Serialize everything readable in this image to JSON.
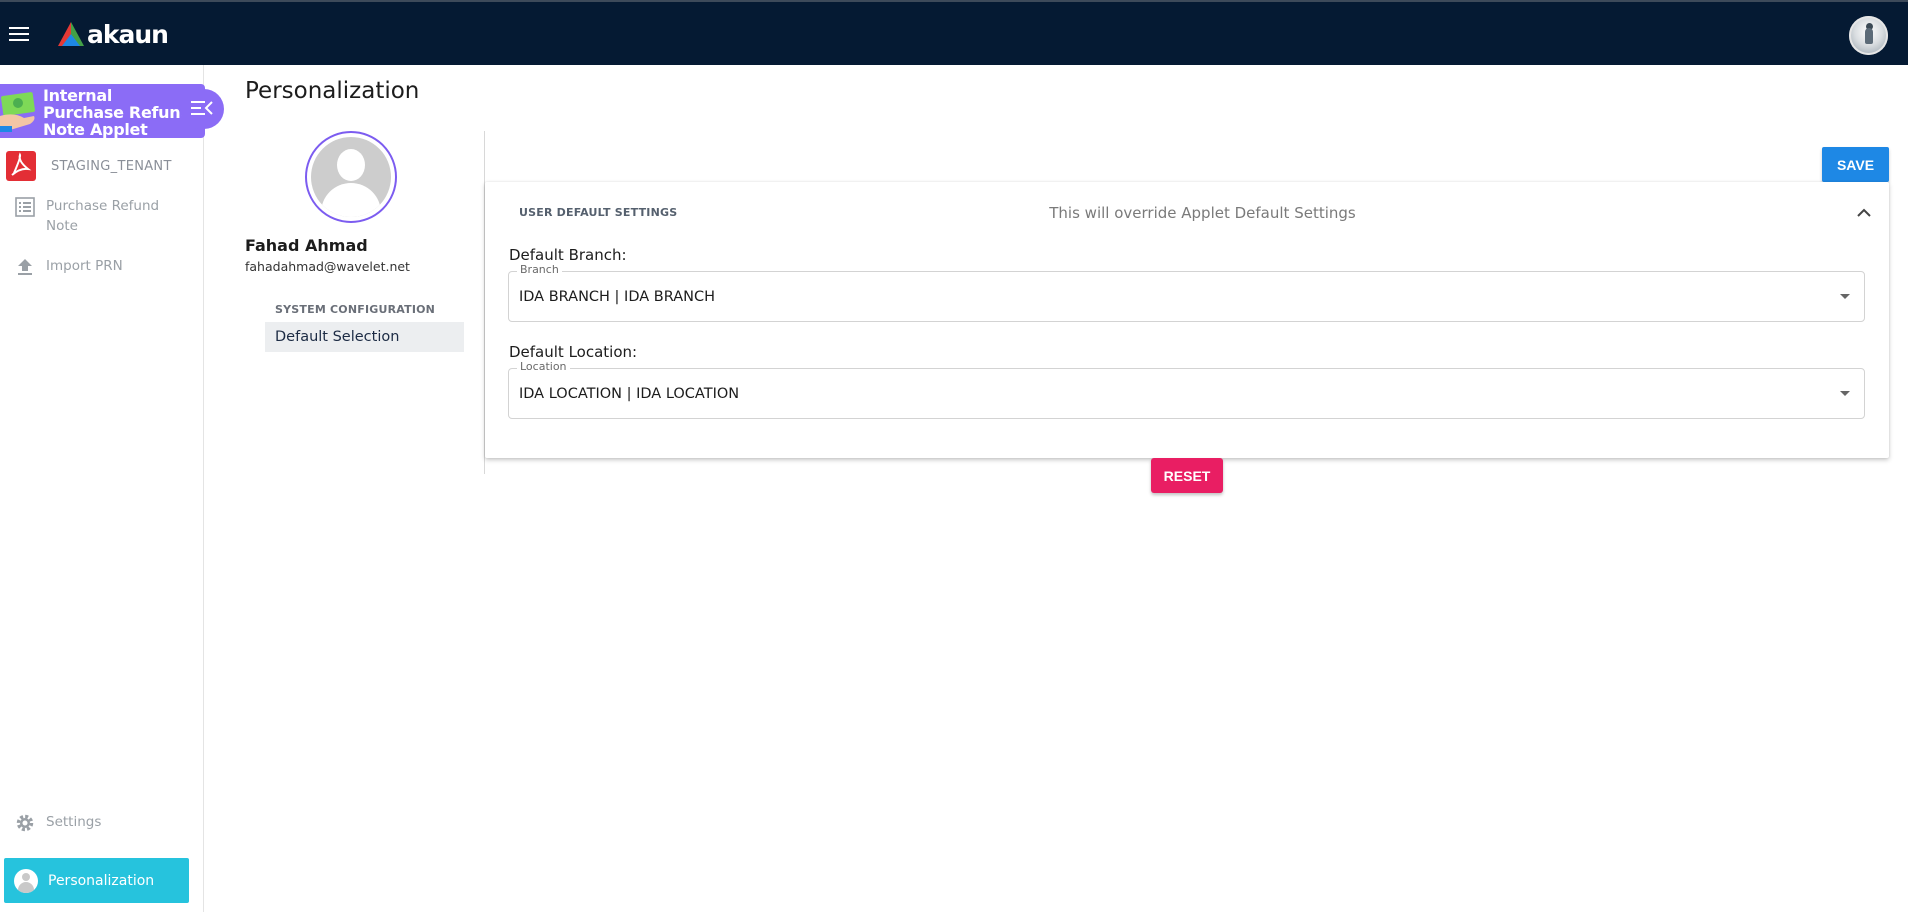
{
  "header": {
    "logo_text": "akaun",
    "menu_icon": "hamburger-icon",
    "avatar_icon": "user-avatar-icon",
    "background": "#051a33"
  },
  "sidebar": {
    "applet_title": "Internal Purchase Refund Note Applet",
    "applet_color": "#8b6cf6",
    "tenant": "STAGING_TENANT",
    "items": [
      {
        "label": "Purchase Refund Note",
        "icon": "list-icon"
      },
      {
        "label": "Import PRN",
        "icon": "upload-icon"
      },
      {
        "label": "Settings",
        "icon": "gear-icon"
      },
      {
        "label": "Personalization",
        "icon": "user-icon",
        "active": true
      }
    ],
    "active_color": "#26c3dd"
  },
  "main": {
    "page_title": "Personalization",
    "user": {
      "name": "Fahad Ahmad",
      "email": "fahadahmad@wavelet.net"
    },
    "nav_section": "SYSTEM CONFIGURATION",
    "nav_item": "Default Selection",
    "save_label": "SAVE",
    "reset_label": "RESET",
    "panel": {
      "title": "USER DEFAULT SETTINGS",
      "subtitle": "This will override Applet Default Settings",
      "branch": {
        "label": "Default Branch:",
        "float_label": "Branch",
        "value": "IDA BRANCH | IDA BRANCH"
      },
      "location": {
        "label": "Default Location:",
        "float_label": "Location",
        "value": "IDA LOCATION | IDA LOCATION"
      }
    },
    "colors": {
      "save": "#1e88e5",
      "reset": "#e91e63"
    }
  }
}
